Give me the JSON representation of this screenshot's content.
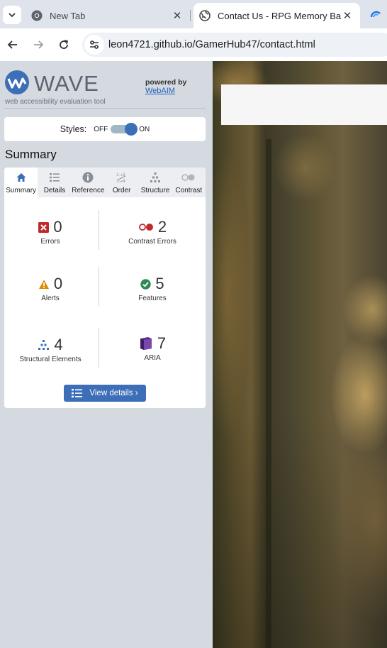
{
  "browser": {
    "tabs": [
      {
        "title": "New Tab",
        "active": false
      },
      {
        "title": "Contact Us - RPG Memory Battle",
        "active": true
      }
    ],
    "url": "leon4721.github.io/GamerHub47/contact.html"
  },
  "wave": {
    "logo_text": "WAVE",
    "tagline": "web accessibility evaluation tool",
    "powered_by": "powered by",
    "webaim_link": "WebAIM",
    "styles": {
      "label": "Styles:",
      "off": "OFF",
      "on": "ON",
      "state": "on"
    },
    "summary_heading": "Summary",
    "panel_tabs": [
      {
        "label": "Summary",
        "icon": "home-icon",
        "active": true
      },
      {
        "label": "Details",
        "icon": "list-icon",
        "active": false
      },
      {
        "label": "Reference",
        "icon": "info-icon",
        "active": false
      },
      {
        "label": "Order",
        "icon": "order-icon",
        "active": false
      },
      {
        "label": "Structure",
        "icon": "structure-icon",
        "active": false
      },
      {
        "label": "Contrast",
        "icon": "contrast-icon",
        "active": false
      }
    ],
    "stats": {
      "errors": {
        "value": "0",
        "label": "Errors"
      },
      "contrast_errors": {
        "value": "2",
        "label": "Contrast Errors"
      },
      "alerts": {
        "value": "0",
        "label": "Alerts"
      },
      "features": {
        "value": "5",
        "label": "Features"
      },
      "structural": {
        "value": "4",
        "label": "Structural Elements"
      },
      "aria": {
        "value": "7",
        "label": "ARIA"
      }
    },
    "view_details": "View details ›"
  },
  "colors": {
    "wave_blue": "#3d6fb8",
    "error_red": "#c0282d",
    "alert_orange": "#e08a00",
    "feature_green": "#2f8a57",
    "aria_purple": "#5b2d8c"
  }
}
